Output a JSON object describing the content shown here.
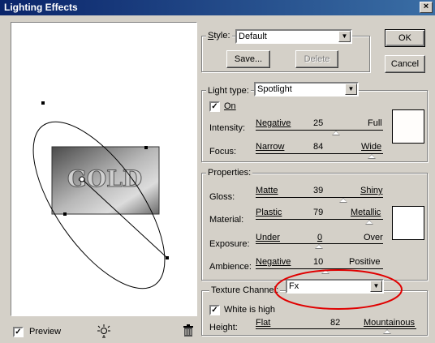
{
  "window": {
    "title": "Lighting Effects",
    "close": "×"
  },
  "preview": {
    "text": "GOLD",
    "checkbox_label": "Preview",
    "checked": true
  },
  "style": {
    "label": "Style:",
    "value": "Default",
    "save": "Save...",
    "delete": "Delete"
  },
  "buttons": {
    "ok": "OK",
    "cancel": "Cancel"
  },
  "light": {
    "type_label": "Light type:",
    "type_value": "Spotlight",
    "on_label": "On",
    "on_checked": true,
    "intensity": {
      "label": "Intensity:",
      "min": "Negative",
      "value": "25",
      "max": "Full",
      "level": 0.62
    },
    "focus": {
      "label": "Focus:",
      "min": "Narrow",
      "value": "84",
      "max": "Wide",
      "level": 0.92
    },
    "color": "#fffdfb"
  },
  "properties": {
    "title": "Properties:",
    "gloss": {
      "label": "Gloss:",
      "min": "Matte",
      "value": "39",
      "max": "Shiny",
      "level": 0.69
    },
    "material": {
      "label": "Material:",
      "min": "Plastic",
      "value": "79",
      "max": "Metallic",
      "level": 0.89
    },
    "exposure": {
      "label": "Exposure:",
      "min": "Under",
      "value": "0",
      "max": "Over",
      "level": 0.5
    },
    "ambience": {
      "label": "Ambience:",
      "min": "Negative",
      "value": "10",
      "max": "Positive",
      "level": 0.55
    },
    "color": "#ffffff"
  },
  "texture": {
    "channel_label": "Texture Channel:",
    "channel_value": "Fx",
    "white_high_label": "White is high",
    "white_high_checked": true,
    "height": {
      "label": "Height:",
      "min": "Flat",
      "value": "82",
      "max": "Mountainous",
      "level": 0.82
    }
  },
  "highlight_color": "#e00000"
}
